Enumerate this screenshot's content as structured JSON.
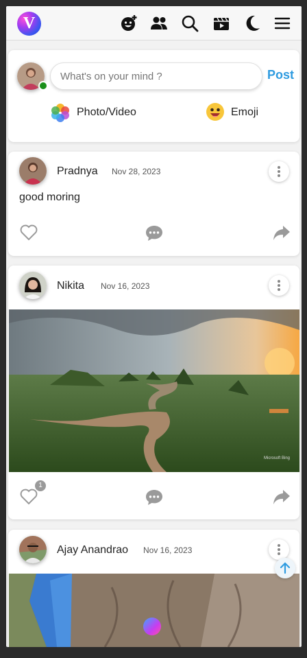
{
  "app": {
    "logo_letter": "V"
  },
  "topbar": {
    "icons": [
      "add-emoji-icon",
      "friends-icon",
      "search-icon",
      "reels-icon",
      "dark-mode-moon-icon",
      "hamburger-menu-icon"
    ]
  },
  "composer": {
    "placeholder": "What's on your mind ?",
    "post_label": "Post",
    "photo_label": "Photo/Video",
    "emoji_label": "Emoji"
  },
  "posts": [
    {
      "author": "Pradnya",
      "date": "Nov 28, 2023",
      "text": "good moring",
      "likes": null
    },
    {
      "author": "Nikita",
      "date": "Nov 16, 2023",
      "text": "",
      "likes": "1",
      "image_watermark": "Microsoft Bing"
    },
    {
      "author": "Ajay Anandrao",
      "date": "Nov 16, 2023",
      "text": "",
      "likes": null
    }
  ],
  "colors": {
    "accent": "#2e9be0",
    "online": "#1a8f1a",
    "icon": "#9a9a9a"
  }
}
